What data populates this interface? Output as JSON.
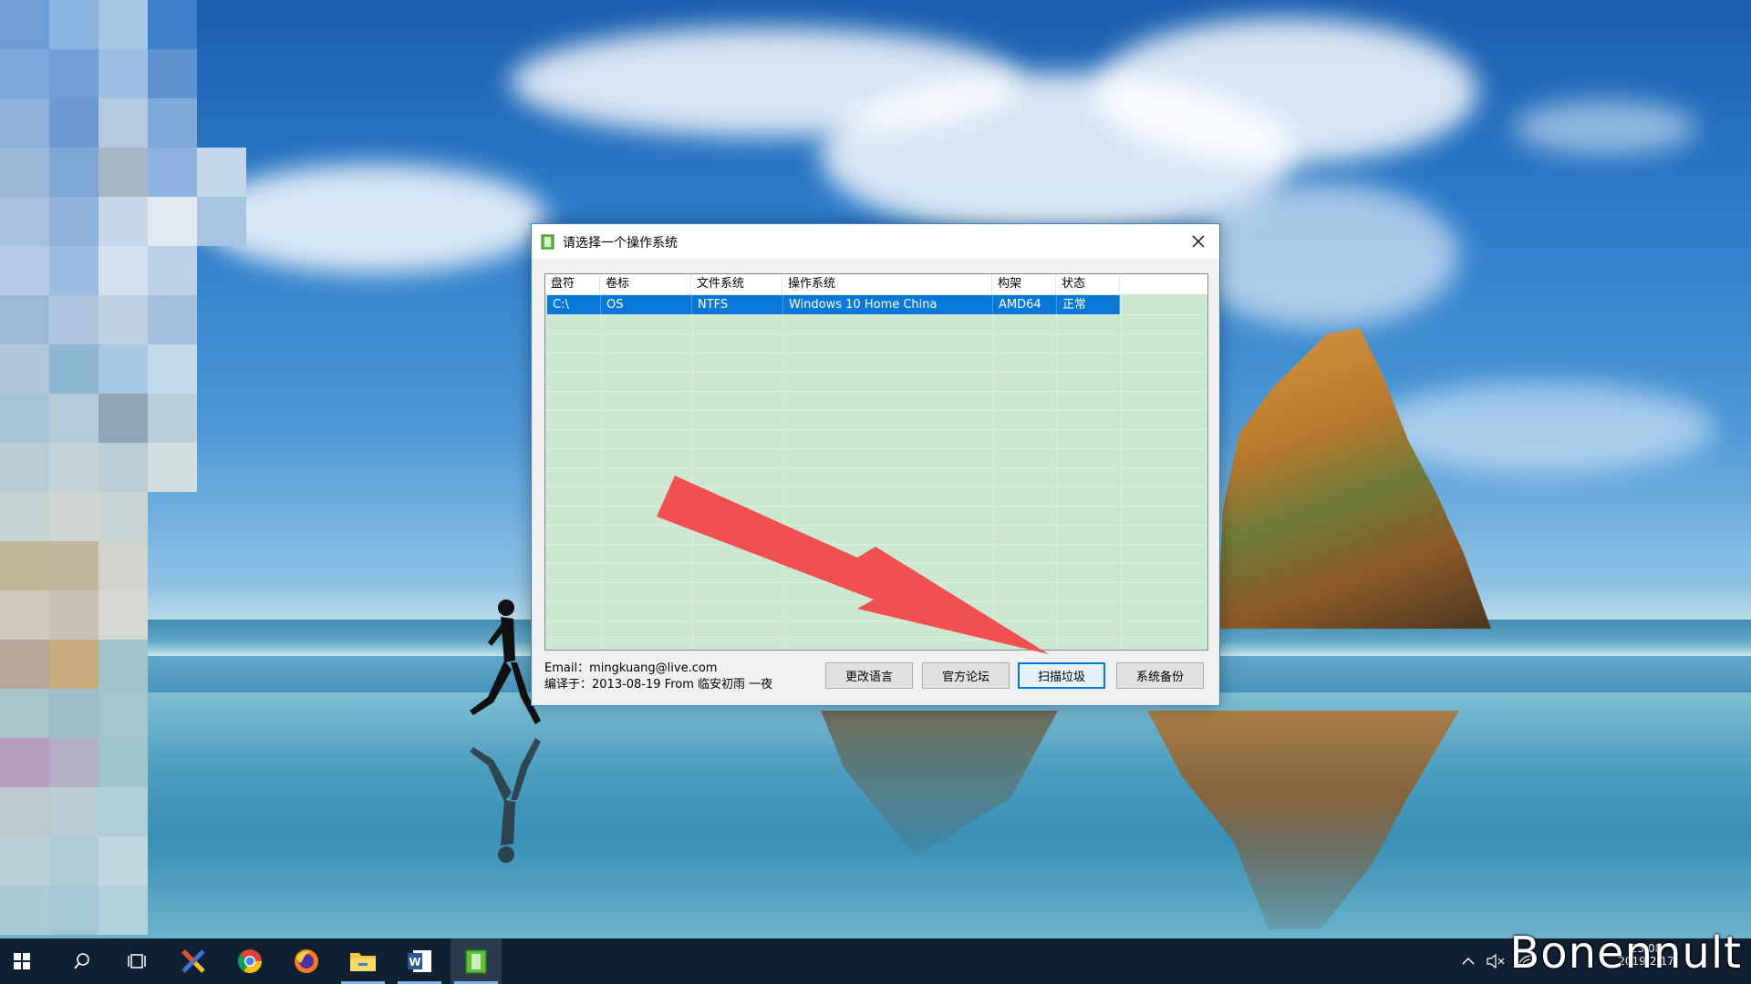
{
  "dialog": {
    "title": "请选择一个操作系统",
    "columns": [
      "盘符",
      "卷标",
      "文件系统",
      "操作系统",
      "构架",
      "状态"
    ],
    "rows": [
      {
        "drive": "C:\\",
        "label": "OS",
        "fs": "NTFS",
        "os": "Windows 10 Home China",
        "arch": "AMD64",
        "status": "正常",
        "selected": true
      }
    ],
    "email": "Email：mingkuang@live.com",
    "compiled": "编译于：2013-08-19 From 临安初雨 一夜",
    "buttons": {
      "change_language": "更改语言",
      "official_forum": "官方论坛",
      "scan_junk": "扫描垃圾",
      "system_backup": "系统备份"
    }
  },
  "taskbar": {
    "icons": [
      "start-icon",
      "search-icon",
      "task-view-icon",
      "xmind-icon",
      "chrome-icon",
      "firefox-icon",
      "file-explorer-icon",
      "word-icon",
      "dism-app-icon"
    ],
    "tray": {
      "time": "23:08",
      "date": "2019/2/17"
    }
  },
  "watermark": "Bonennult",
  "colors": {
    "selection": "#0a78d7",
    "list_background": "#cde8d1",
    "arrow": "#f05050",
    "taskbar": "#102033"
  }
}
